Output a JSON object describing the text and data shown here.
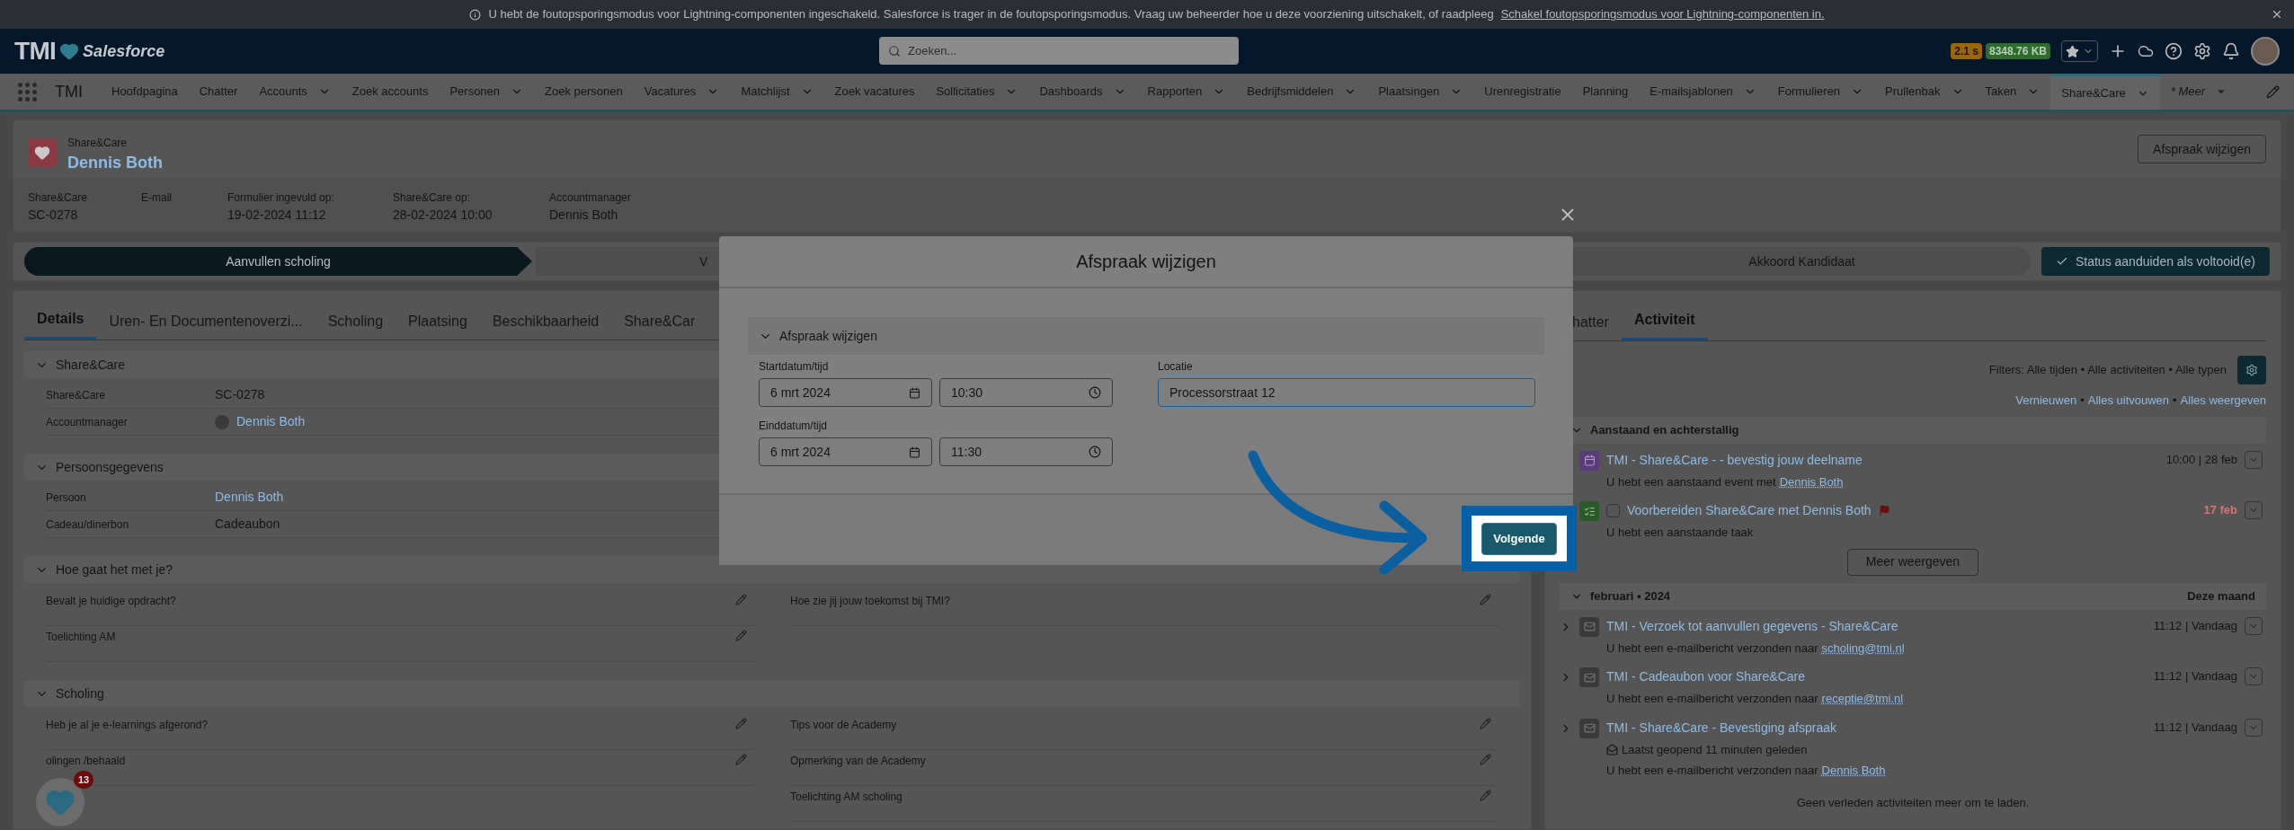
{
  "banner": {
    "text": "U hebt de foutopsporingsmodus voor Lightning-componenten ingeschakeld. Salesforce is trager in de foutopsporingsmodus. Vraag uw beheerder hoe u deze voorziening uitschakelt, of raadpleeg",
    "link": "Schakel foutopsporingsmodus voor Lightning-componenten in."
  },
  "header": {
    "logo": "TMI",
    "brand": "Salesforce",
    "search_placeholder": "Zoeken...",
    "ept_time": "2.1 s",
    "ept_size": "8348.76 KB"
  },
  "nav": {
    "app": "TMI",
    "items": [
      {
        "label": "Hoofdpagina",
        "menu": false,
        "selected": false
      },
      {
        "label": "Chatter",
        "menu": false,
        "selected": false
      },
      {
        "label": "Accounts",
        "menu": true,
        "selected": false
      },
      {
        "label": "Zoek accounts",
        "menu": false,
        "selected": false
      },
      {
        "label": "Personen",
        "menu": true,
        "selected": false
      },
      {
        "label": "Zoek personen",
        "menu": false,
        "selected": false
      },
      {
        "label": "Vacatures",
        "menu": true,
        "selected": false
      },
      {
        "label": "Matchlijst",
        "menu": true,
        "selected": false
      },
      {
        "label": "Zoek vacatures",
        "menu": false,
        "selected": false
      },
      {
        "label": "Sollicitaties",
        "menu": true,
        "selected": false
      },
      {
        "label": "Dashboards",
        "menu": true,
        "selected": false
      },
      {
        "label": "Rapporten",
        "menu": true,
        "selected": false
      },
      {
        "label": "Bedrijfsmiddelen",
        "menu": true,
        "selected": false
      },
      {
        "label": "Plaatsingen",
        "menu": true,
        "selected": false
      },
      {
        "label": "Urenregistratie",
        "menu": false,
        "selected": false
      },
      {
        "label": "Planning",
        "menu": false,
        "selected": false
      },
      {
        "label": "E-mailsjablonen",
        "menu": true,
        "selected": false
      },
      {
        "label": "Formulieren",
        "menu": true,
        "selected": false
      },
      {
        "label": "Prullenbak",
        "menu": true,
        "selected": false
      },
      {
        "label": "Taken",
        "menu": true,
        "selected": false
      },
      {
        "label": "Share&Care",
        "menu": true,
        "selected": true
      }
    ],
    "more": "* Meer"
  },
  "record": {
    "object": "Share&Care",
    "title": "Dennis Both",
    "button": "Afspraak wijzigen",
    "fields": [
      {
        "label": "Share&Care",
        "value": "SC-0278"
      },
      {
        "label": "E-mail"
      },
      {
        "label": "Formulier ingevuld op:",
        "value": "19-02-2024 11:12"
      },
      {
        "label": "Share&Care op:",
        "value": "28-02-2024 10:00"
      },
      {
        "label": "Accountmanager",
        "value": "Dennis Both"
      }
    ]
  },
  "path": {
    "stages": [
      {
        "label": "Aanvullen scholing",
        "selected": true
      },
      {
        "label": "V",
        "selected": false
      },
      {
        "label": "Akkoord Kandidaat",
        "selected": false
      }
    ],
    "button": "Status aanduiden als voltooid(e)"
  },
  "details": {
    "tabs": [
      {
        "label": "Details",
        "selected": true
      },
      {
        "label": "Uren- En Documentenoverzi...",
        "selected": false
      },
      {
        "label": "Scholing",
        "selected": false
      },
      {
        "label": "Plaatsing",
        "selected": false
      },
      {
        "label": "Beschikbaarheid",
        "selected": false
      },
      {
        "label": "Share&Car",
        "selected": false
      }
    ],
    "sections": [
      {
        "title": "Share&Care",
        "kind": "pairs",
        "rows": [
          {
            "label": "Share&Care",
            "value": "SC-0278",
            "link": false,
            "avatar": false
          },
          {
            "label": "Accountmanager",
            "value": "Dennis Both",
            "link": true,
            "avatar": true
          }
        ]
      },
      {
        "title": "Persoonsgegevens",
        "kind": "pairs",
        "rows": [
          {
            "label": "Persoon",
            "value": "Dennis Both",
            "link": true,
            "avatar": false
          },
          {
            "label": "Cadeau/dinerbon",
            "value": "Cadeaubon",
            "link": false,
            "avatar": false
          }
        ]
      },
      {
        "title": "Hoe gaat het met je?",
        "kind": "questions",
        "left": [
          "Bevalt je huidige opdracht?",
          "Toelichting AM"
        ],
        "right": [
          "Hoe zie jij jouw toekomst bij TMI?"
        ]
      },
      {
        "title": "Scholing",
        "kind": "questions",
        "left": [
          "Heb je al je e-learnings afgerond?",
          "olingen /behaald"
        ],
        "right": [
          "Tips voor de Academy",
          "Opmerking van de Academy",
          "Toelichting AM scholing"
        ]
      }
    ]
  },
  "activity": {
    "tabs": [
      {
        "label": "hatter",
        "selected": false
      },
      {
        "label": "Activiteit",
        "selected": true
      }
    ],
    "filters": "Filters: Alle tijden • Alle activiteiten • Alle typen",
    "links": [
      "Vernieuwen",
      "Alles uitvouwen",
      "Alles weergeven"
    ],
    "link_separator": "•",
    "groups": [
      {
        "title": "Aanstaand en achterstallig",
        "items": [
          {
            "kind": "event",
            "title": "TMI - Share&Care - - bevestig jouw deelname",
            "date": "10:00 | 28 feb",
            "overdue": false,
            "flag": false,
            "lines": [
              {
                "text": "U hebt een aanstaand event met",
                "link": "Dennis Both"
              }
            ]
          },
          {
            "kind": "task",
            "title": "Voorbereiden Share&Care met Dennis Both",
            "checked": false,
            "date": "17 feb",
            "overdue": true,
            "flag": true,
            "lines": [
              {
                "text": "U hebt een aanstaande taak"
              }
            ]
          }
        ],
        "more": "Meer weergeven"
      },
      {
        "title": "februari • 2024",
        "note": "Deze maand",
        "items": [
          {
            "kind": "email",
            "title": "TMI - Verzoek tot aanvullen gegevens - Share&Care",
            "date": "11:12 | Vandaag",
            "overdue": false,
            "flag": false,
            "lines": [
              {
                "text": "U hebt een e-mailbericht verzonden naar",
                "link": "scholing@tmi.nl"
              }
            ]
          },
          {
            "kind": "email",
            "title": "TMI - Cadeaubon voor Share&Care",
            "date": "11:12 | Vandaag",
            "overdue": false,
            "flag": false,
            "lines": [
              {
                "text": "U hebt een e-mailbericht verzonden naar",
                "link": "receptie@tmi.nl"
              }
            ]
          },
          {
            "kind": "email",
            "title": "TMI - Share&Care - Bevestiging afspraak",
            "date": "11:12 | Vandaag",
            "overdue": false,
            "flag": false,
            "lines": [
              {
                "text": "Laatst geopend 11 minuten geleden",
                "opened": true
              },
              {
                "text": "U hebt een e-mailbericht verzonden naar",
                "link": "Dennis Both"
              }
            ]
          }
        ]
      }
    ],
    "footer": "Geen verleden activiteiten meer om te laden."
  },
  "modal": {
    "title": "Afspraak wijzigen",
    "section": "Afspraak wijzigen",
    "start": {
      "label": "Startdatum/tijd",
      "date": "6 mrt 2024",
      "time": "10:30"
    },
    "end": {
      "label": "Einddatum/tijd",
      "date": "6 mrt 2024",
      "time": "11:30"
    },
    "location": {
      "label": "Locatie",
      "value": "Processorstraat 12"
    },
    "button": "Volgende"
  },
  "fab": {
    "badge": "13"
  }
}
